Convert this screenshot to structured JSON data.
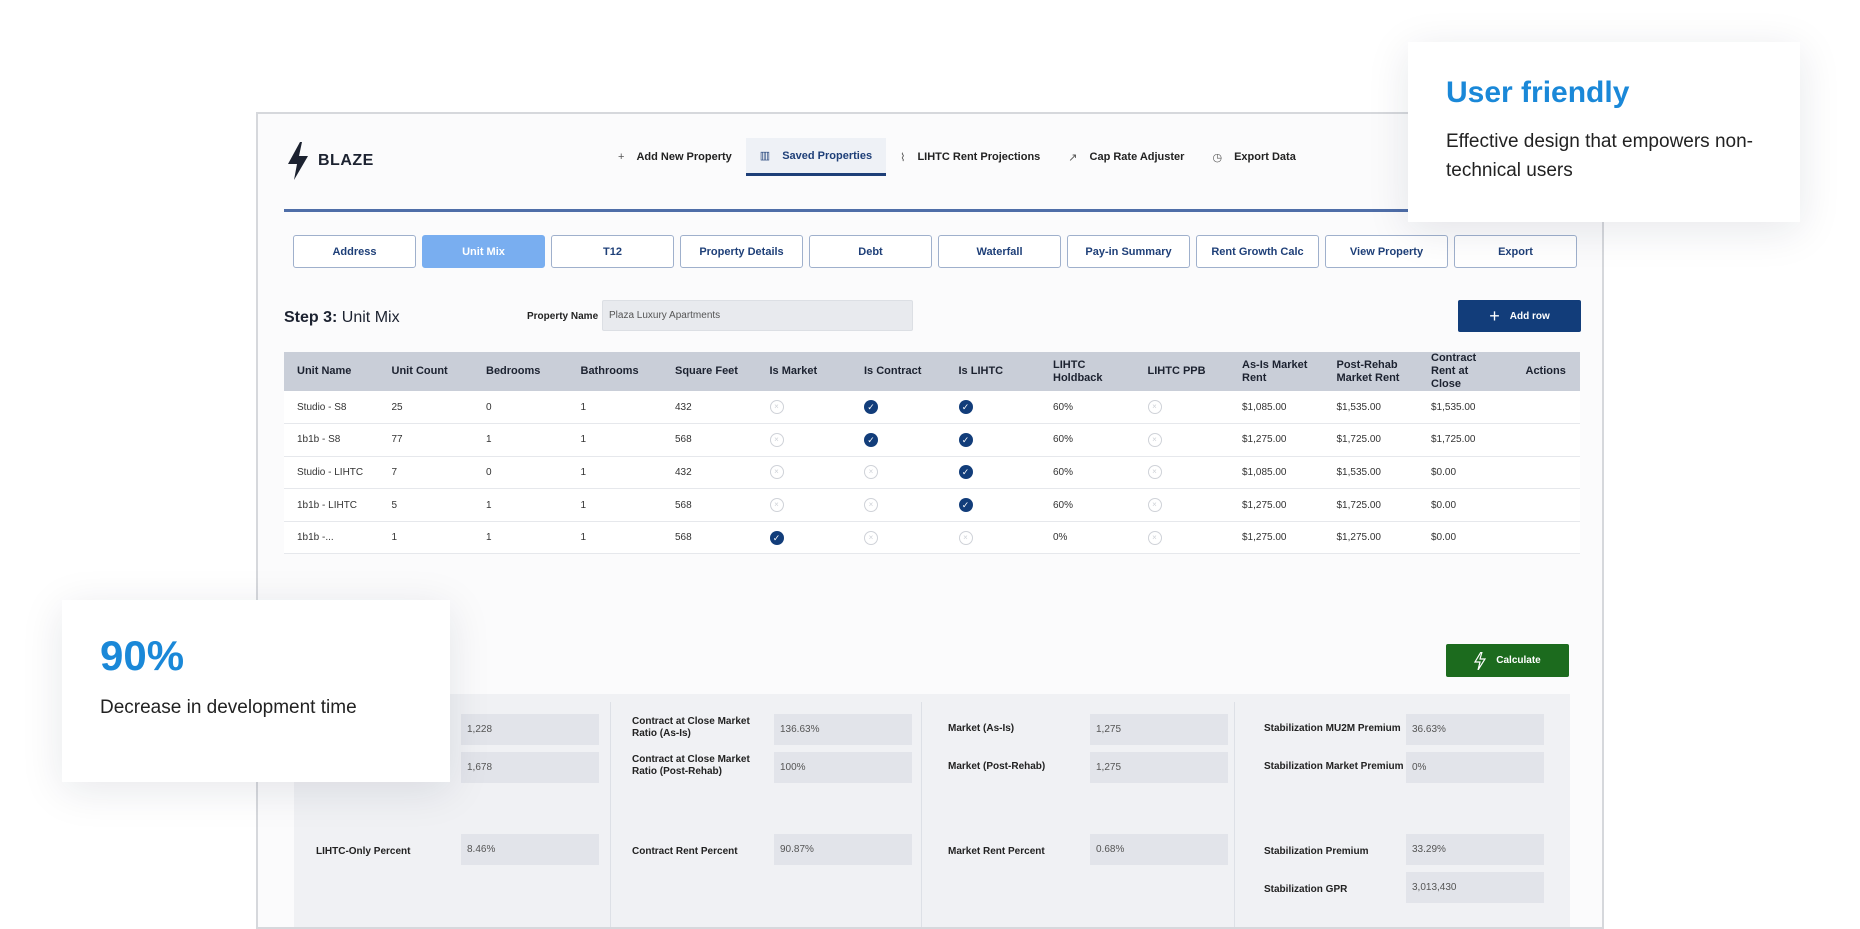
{
  "app": {
    "brand": "BLAZE",
    "nav": [
      {
        "label": "Add New Property",
        "icon": "plus-icon"
      },
      {
        "label": "Saved Properties",
        "icon": "building-icon",
        "active": true
      },
      {
        "label": "LIHTC Rent Projections",
        "icon": "trend-icon"
      },
      {
        "label": "Cap Rate Adjuster",
        "icon": "trend-up-icon"
      },
      {
        "label": "Export Data",
        "icon": "clock-icon"
      }
    ],
    "tabs": [
      "Address",
      "Unit Mix",
      "T12",
      "Property Details",
      "Debt",
      "Waterfall",
      "Pay-in Summary",
      "Rent Growth Calc",
      "View Property",
      "Export"
    ],
    "active_tab": "Unit Mix",
    "step_prefix": "Step 3:",
    "step_name": "Unit Mix",
    "property_name_label": "Property Name",
    "property_name_value": "Plaza Luxury Apartments",
    "add_row_label": "Add row",
    "calculate_label": "Calculate",
    "colors": {
      "primary": "#123d7a",
      "active_tab": "#79aef0",
      "calculate": "#1c6b1e",
      "accent": "#1a88d8"
    }
  },
  "table": {
    "headers": [
      "Unit Name",
      "Unit Count",
      "Bedrooms",
      "Bathrooms",
      "Square Feet",
      "Is Market",
      "Is Contract",
      "Is LIHTC",
      "LIHTC Holdback",
      "LIHTC PPB",
      "As-Is Market Rent",
      "Post-Rehab Market Rent",
      "Contract Rent at Close",
      "Actions"
    ],
    "rows": [
      {
        "name": "Studio - S8",
        "count": "25",
        "bed": "0",
        "bath": "1",
        "sqft": "432",
        "market": false,
        "contract": true,
        "lihtc": true,
        "holdback": "60%",
        "ppb": false,
        "asis": "$1,085.00",
        "post": "$1,535.00",
        "contract_rent": "$1,535.00"
      },
      {
        "name": "1b1b - S8",
        "count": "77",
        "bed": "1",
        "bath": "1",
        "sqft": "568",
        "market": false,
        "contract": true,
        "lihtc": true,
        "holdback": "60%",
        "ppb": false,
        "asis": "$1,275.00",
        "post": "$1,725.00",
        "contract_rent": "$1,725.00"
      },
      {
        "name": "Studio - LIHTC",
        "count": "7",
        "bed": "0",
        "bath": "1",
        "sqft": "432",
        "market": false,
        "contract": false,
        "lihtc": true,
        "holdback": "60%",
        "ppb": false,
        "asis": "$1,085.00",
        "post": "$1,535.00",
        "contract_rent": "$0.00"
      },
      {
        "name": "1b1b - LIHTC",
        "count": "5",
        "bed": "1",
        "bath": "1",
        "sqft": "568",
        "market": false,
        "contract": false,
        "lihtc": true,
        "holdback": "60%",
        "ppb": false,
        "asis": "$1,275.00",
        "post": "$1,725.00",
        "contract_rent": "$0.00"
      },
      {
        "name": "1b1b -...",
        "count": "1",
        "bed": "1",
        "bath": "1",
        "sqft": "568",
        "market": true,
        "contract": false,
        "lihtc": false,
        "holdback": "0%",
        "ppb": false,
        "asis": "$1,275.00",
        "post": "$1,275.00",
        "contract_rent": "$0.00"
      }
    ]
  },
  "summary": {
    "col1": {
      "v1": "1,228",
      "v2": "1,678",
      "lihtc_only_label": "LIHTC-Only Percent",
      "lihtc_only_value": "8.46%"
    },
    "col2": {
      "l1": "Contract at Close Market Ratio (As-Is)",
      "v1": "136.63%",
      "l2": "Contract at Close Market Ratio (Post-Rehab)",
      "v2": "100%",
      "l3": "Contract Rent Percent",
      "v3": "90.87%"
    },
    "col3": {
      "l1": "Market (As-Is)",
      "v1": "1,275",
      "l2": "Market (Post-Rehab)",
      "v2": "1,275",
      "l3": "Market Rent Percent",
      "v3": "0.68%"
    },
    "col4": {
      "l1": "Stabilization MU2M Premium",
      "v1": "36.63%",
      "l2": "Stabilization Market Premium",
      "v2": "0%",
      "l3": "Stabilization Premium",
      "v3": "33.29%",
      "l4": "Stabilization GPR",
      "v4": "3,013,430"
    }
  },
  "cards": {
    "user_friendly": {
      "title": "User friendly",
      "desc": "Effective design that empowers non-technical users"
    },
    "stat": {
      "value": "90%",
      "desc": "Decrease in development time"
    }
  }
}
